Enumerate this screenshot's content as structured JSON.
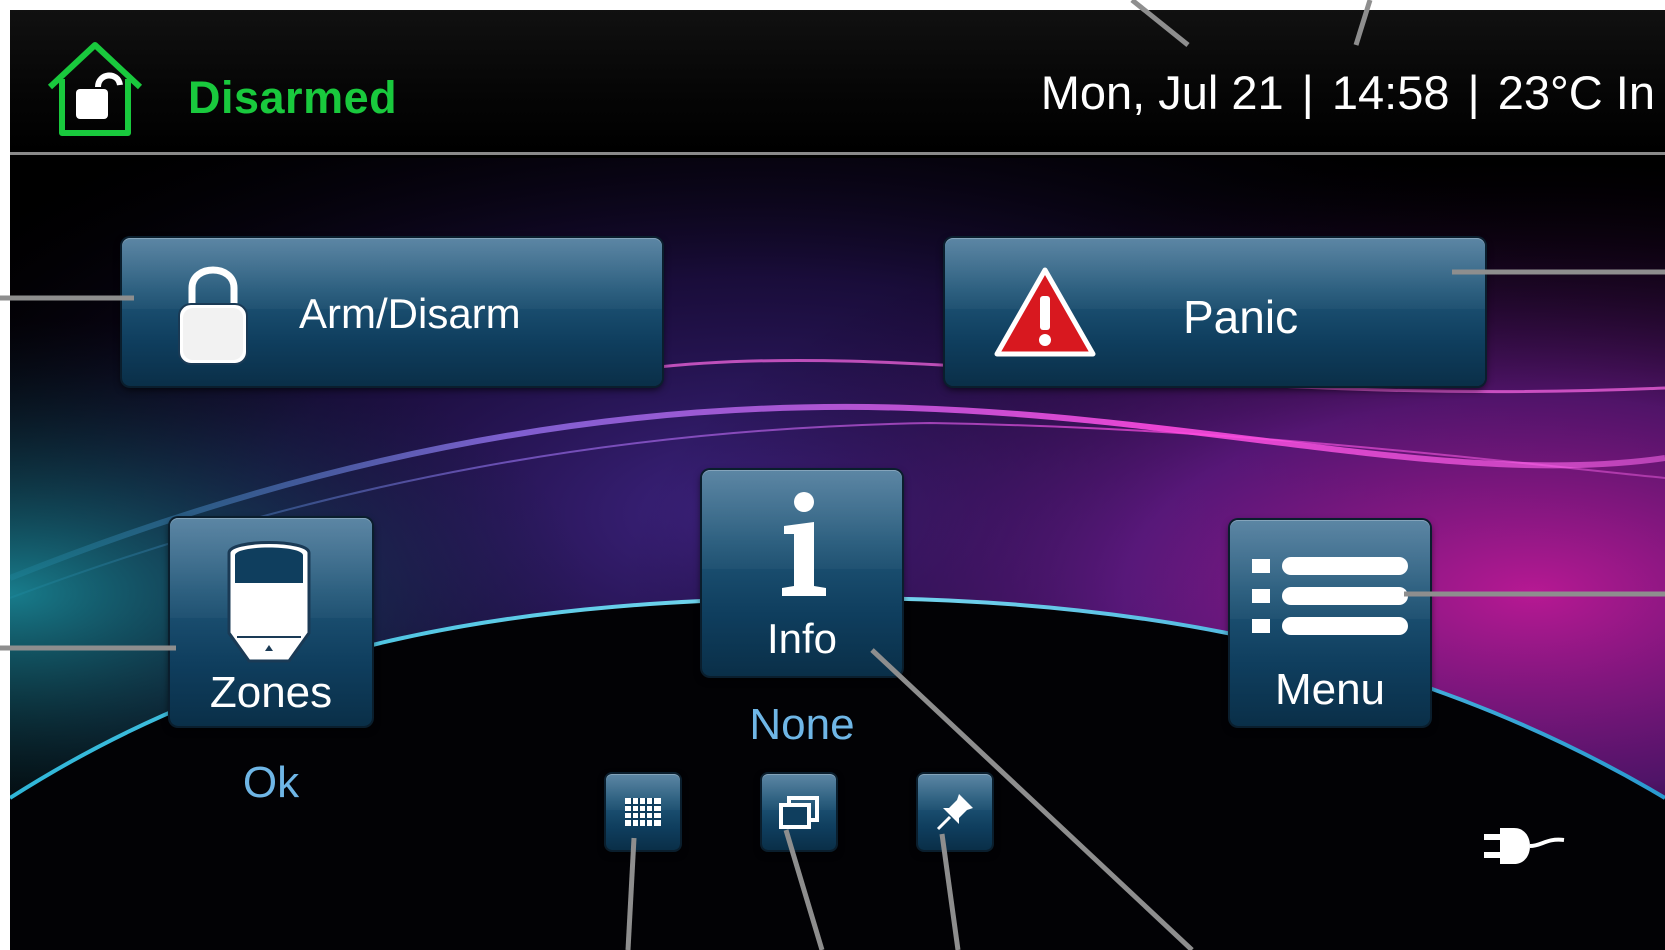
{
  "status_bar": {
    "arm_state": "Disarmed",
    "date": "Mon, Jul 21",
    "separator": "|",
    "time": "14:58",
    "temperature": "23°C In",
    "state_color": "#19c93d",
    "icon": "house-unlocked-icon"
  },
  "buttons": {
    "arm_disarm": {
      "label": "Arm/Disarm",
      "icon": "padlock-icon"
    },
    "panic": {
      "label": "Panic",
      "icon": "warning-triangle-icon"
    },
    "zones": {
      "label": "Zones",
      "status": "Ok",
      "icon": "motion-sensor-icon"
    },
    "info": {
      "label": "Info",
      "status": "None",
      "icon": "info-icon"
    },
    "menu": {
      "label": "Menu",
      "icon": "list-menu-icon"
    }
  },
  "shortcuts": [
    {
      "icon": "keypad-grid-icon"
    },
    {
      "icon": "windows-icon"
    },
    {
      "icon": "pushpin-icon"
    }
  ],
  "power": {
    "icon": "ac-plug-icon"
  },
  "colors": {
    "accent_blue": "#6fb6e6",
    "button_blue": "#1f5577",
    "glow_magenta": "#ff2bd6",
    "panic_red": "#d8181f"
  }
}
